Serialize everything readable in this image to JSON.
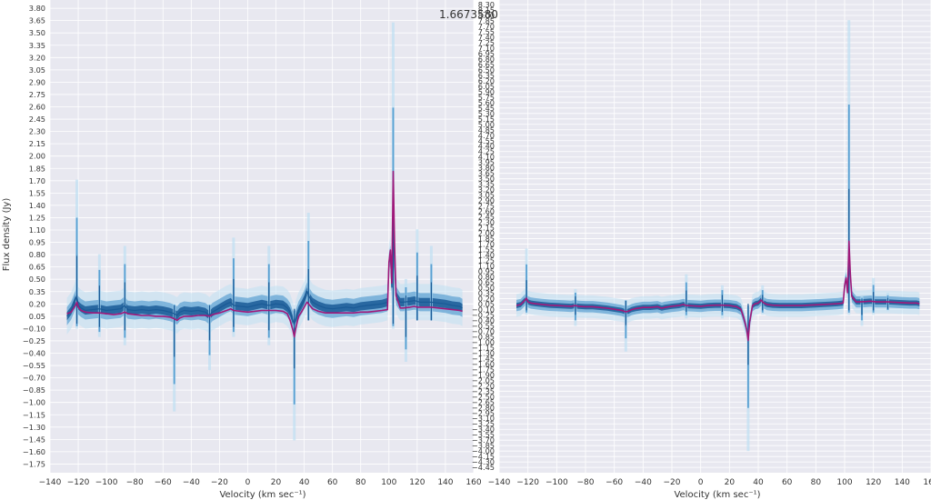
{
  "annotation": "1.6673580",
  "colors": {
    "panel_bg": "#e8e8f0",
    "grid": "#ffffff",
    "band_outer": "#bfe0f2",
    "band_mid": "#5aa0d2",
    "band_inner": "#1a5a96",
    "median": "#a0197a"
  },
  "chart_data": [
    {
      "type": "line",
      "xlabel": "Velocity (km sec⁻¹)",
      "ylabel": "Flux density (Jy)",
      "xlim": [
        -140,
        160
      ],
      "ylim": [
        -1.84,
        3.87
      ],
      "grid": true,
      "xticks": [
        "−140",
        "−120",
        "−100",
        "−80",
        "−60",
        "−40",
        "−20",
        "0",
        "20",
        "40",
        "60",
        "80",
        "100",
        "120",
        "140",
        "160"
      ],
      "yticks": [
        "3.80",
        "3.65",
        "3.50",
        "3.35",
        "3.20",
        "3.05",
        "2.90",
        "2.75",
        "2.60",
        "2.45",
        "2.30",
        "2.15",
        "2.00",
        "1.85",
        "1.70",
        "1.55",
        "1.40",
        "1.25",
        "1.10",
        "0.95",
        "0.80",
        "0.65",
        "0.50",
        "0.35",
        "0.20",
        "0.05",
        "−0.10",
        "−0.25",
        "−0.40",
        "−0.55",
        "−0.70",
        "−0.85",
        "−1.00",
        "−1.15",
        "−1.30",
        "−1.45",
        "−1.60",
        "−1.75"
      ],
      "x": [
        -128,
        -125,
        -122,
        -121,
        -120,
        -118,
        -115,
        -110,
        -105,
        -100,
        -95,
        -90,
        -87,
        -85,
        -80,
        -75,
        -70,
        -65,
        -60,
        -55,
        -52,
        -50,
        -48,
        -45,
        -40,
        -35,
        -30,
        -27,
        -25,
        -20,
        -15,
        -12,
        -10,
        -5,
        0,
        5,
        10,
        15,
        20,
        25,
        28,
        30,
        32,
        33,
        34,
        36,
        38,
        40,
        42,
        43,
        44,
        46,
        50,
        55,
        60,
        65,
        70,
        75,
        80,
        85,
        90,
        95,
        99,
        100,
        101,
        102,
        103,
        104,
        105,
        108,
        110,
        115,
        118,
        120,
        122,
        125,
        130,
        135,
        140,
        145,
        150,
        152
      ],
      "series": [
        {
          "values": [
            0.05,
            0.12,
            0.25,
            0.3,
            0.18,
            0.15,
            0.12,
            0.13,
            0.14,
            0.12,
            0.13,
            0.14,
            0.18,
            0.13,
            0.12,
            0.13,
            0.12,
            0.13,
            0.12,
            0.1,
            0.08,
            0.06,
            0.1,
            0.12,
            0.11,
            0.12,
            0.1,
            0.06,
            0.1,
            0.15,
            0.2,
            0.22,
            0.18,
            0.17,
            0.16,
            0.18,
            0.2,
            0.18,
            0.2,
            0.19,
            0.15,
            0.1,
            0.0,
            -0.05,
            0.02,
            0.12,
            0.18,
            0.25,
            0.35,
            0.3,
            0.27,
            0.22,
            0.18,
            0.15,
            0.14,
            0.15,
            0.16,
            0.15,
            0.17,
            0.18,
            0.19,
            0.2,
            0.22,
            0.7,
            0.8,
            0.4,
            1.3,
            0.7,
            0.3,
            0.22,
            0.22,
            0.23,
            0.24,
            0.23,
            0.22,
            0.22,
            0.22,
            0.21,
            0.2,
            0.18,
            0.17,
            0.15
          ]
        },
        {
          "values": [
            0.08,
            0.1,
            0.18,
            0.22,
            0.16,
            0.12,
            0.1,
            0.09,
            0.09,
            0.08,
            0.07,
            0.08,
            0.1,
            0.08,
            0.07,
            0.06,
            0.06,
            0.05,
            0.05,
            0.04,
            0.02,
            0.0,
            0.03,
            0.05,
            0.05,
            0.06,
            0.06,
            0.05,
            0.07,
            0.09,
            0.12,
            0.14,
            0.12,
            0.11,
            0.1,
            0.11,
            0.12,
            0.12,
            0.12,
            0.11,
            0.08,
            0.0,
            -0.12,
            -0.2,
            -0.1,
            0.05,
            0.1,
            0.16,
            0.22,
            0.2,
            0.18,
            0.14,
            0.11,
            0.09,
            0.09,
            0.09,
            0.09,
            0.09,
            0.1,
            0.1,
            0.11,
            0.12,
            0.13,
            0.7,
            0.85,
            0.45,
            1.8,
            0.9,
            0.3,
            0.15,
            0.15,
            0.16,
            0.17,
            0.16,
            0.16,
            0.16,
            0.16,
            0.15,
            0.14,
            0.13,
            0.12,
            0.11
          ]
        }
      ]
    },
    {
      "type": "line",
      "xlabel": "Velocity (km sec⁻¹)",
      "ylabel": "",
      "xlim": [
        -140,
        160
      ],
      "ylim": [
        -4.49,
        8.35
      ],
      "grid": true,
      "xticks": [
        "−140",
        "−120",
        "−100",
        "−80",
        "−60",
        "−40",
        "−20",
        "0",
        "20",
        "40",
        "60",
        "80",
        "100",
        "120",
        "140",
        "160"
      ],
      "yticks": [
        "8.30",
        "8.15",
        "8.00",
        "7.85",
        "7.70",
        "7.55",
        "7.40",
        "7.25",
        "7.10",
        "6.95",
        "6.80",
        "6.65",
        "6.50",
        "6.35",
        "6.20",
        "6.05",
        "5.90",
        "5.75",
        "5.60",
        "5.45",
        "5.30",
        "5.15",
        "5.00",
        "4.85",
        "4.70",
        "4.55",
        "4.40",
        "4.25",
        "4.10",
        "3.95",
        "3.80",
        "3.65",
        "3.50",
        "3.35",
        "3.20",
        "3.05",
        "2.90",
        "2.75",
        "2.60",
        "2.45",
        "2.30",
        "2.15",
        "2.00",
        "1.85",
        "1.70",
        "1.55",
        "1.40",
        "1.25",
        "1.10",
        "0.95",
        "0.80",
        "0.65",
        "0.50",
        "0.35",
        "0.20",
        "0.05",
        "−0.10",
        "−0.25",
        "−0.40",
        "−0.55",
        "−0.70",
        "−0.85",
        "−1.00",
        "−1.15",
        "−1.30",
        "−1.45",
        "−1.60",
        "−1.75",
        "−1.90",
        "−2.05",
        "−2.20",
        "−2.35",
        "−2.50",
        "−2.65",
        "−2.80",
        "−2.95",
        "−3.10",
        "−3.25",
        "−3.40",
        "−3.55",
        "−3.70",
        "−3.85",
        "−4.00",
        "−4.15",
        "−4.30",
        "−4.45"
      ],
      "x": [
        -128,
        -125,
        -122,
        -121,
        -120,
        -118,
        -115,
        -110,
        -105,
        -100,
        -95,
        -90,
        -87,
        -85,
        -80,
        -75,
        -70,
        -65,
        -60,
        -55,
        -52,
        -50,
        -48,
        -45,
        -40,
        -35,
        -30,
        -27,
        -25,
        -20,
        -15,
        -12,
        -10,
        -5,
        0,
        5,
        10,
        15,
        20,
        25,
        28,
        30,
        32,
        33,
        34,
        36,
        38,
        40,
        42,
        43,
        44,
        46,
        50,
        55,
        60,
        65,
        70,
        75,
        80,
        85,
        90,
        95,
        99,
        100,
        101,
        102,
        103,
        104,
        105,
        108,
        110,
        115,
        118,
        120,
        122,
        125,
        130,
        135,
        140,
        145,
        150,
        152
      ],
      "series": [
        {
          "values": [
            0.05,
            0.08,
            0.2,
            0.25,
            0.15,
            0.12,
            0.1,
            0.08,
            0.06,
            0.05,
            0.04,
            0.03,
            0.05,
            0.03,
            0.02,
            0.02,
            0.0,
            -0.02,
            -0.05,
            -0.08,
            -0.12,
            -0.1,
            -0.06,
            -0.03,
            0.0,
            0.0,
            0.02,
            -0.02,
            0.0,
            0.03,
            0.05,
            0.08,
            0.05,
            0.04,
            0.03,
            0.05,
            0.06,
            0.06,
            0.05,
            0.02,
            -0.05,
            -0.3,
            -0.6,
            -0.9,
            -0.4,
            0.05,
            0.1,
            0.12,
            0.2,
            0.15,
            0.12,
            0.08,
            0.06,
            0.05,
            0.05,
            0.05,
            0.05,
            0.06,
            0.07,
            0.08,
            0.09,
            0.1,
            0.12,
            0.6,
            0.8,
            0.4,
            1.8,
            0.9,
            0.3,
            0.15,
            0.15,
            0.16,
            0.17,
            0.16,
            0.15,
            0.15,
            0.15,
            0.14,
            0.13,
            0.12,
            0.12,
            0.1
          ]
        }
      ]
    }
  ]
}
